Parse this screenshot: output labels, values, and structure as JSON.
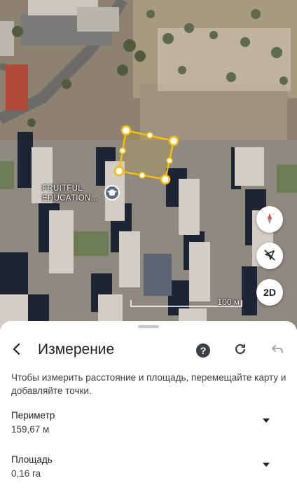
{
  "map": {
    "poi_label": "FRUITFUL EDUCATION...",
    "poi_icon": "graduation-cap-icon",
    "scale_label": "100 м",
    "buttons": {
      "compass": "compass-icon",
      "location": "location-off-icon",
      "view_mode": "2D"
    },
    "measure_color": "#fbbc04"
  },
  "sheet": {
    "title": "Измерение",
    "description": "Чтобы измерить расстояние и площадь, перемещайте карту и добавляйте точки.",
    "perimeter": {
      "label": "Периметр",
      "value": "159,67 м"
    },
    "area": {
      "label": "Площадь",
      "value": "0,16 га"
    }
  }
}
